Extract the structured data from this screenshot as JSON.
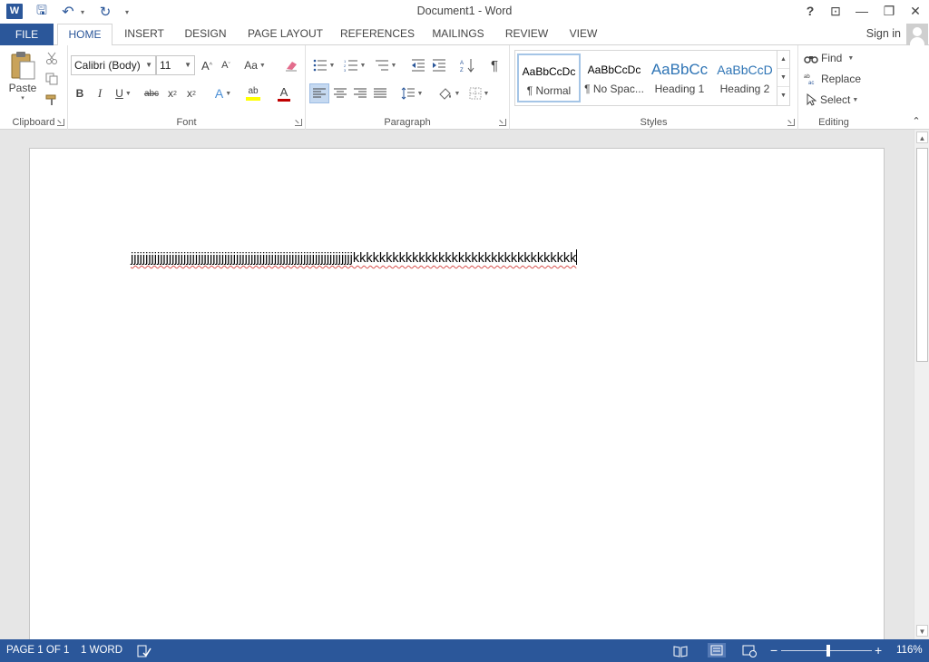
{
  "window": {
    "title": "Document1 - Word",
    "app_icon_letter": "W",
    "help": "?",
    "ribbon_options": "⊡",
    "minimize": "—",
    "restore": "❐",
    "close": "✕"
  },
  "quick_access": {
    "save": "🖫",
    "undo": "↶",
    "undo_dd": "▾",
    "redo": "↻",
    "customize": "▾"
  },
  "tabs": {
    "file": "FILE",
    "items": [
      "HOME",
      "INSERT",
      "DESIGN",
      "PAGE LAYOUT",
      "REFERENCES",
      "MAILINGS",
      "REVIEW",
      "VIEW"
    ],
    "sign_in": "Sign in"
  },
  "ribbon": {
    "clipboard": {
      "label": "Clipboard",
      "paste": "Paste",
      "paste_dd": "▾"
    },
    "font": {
      "label": "Font",
      "font_name": "Calibri (Body)",
      "font_size": "11",
      "grow": "A",
      "shrink": "A",
      "case": "Aa",
      "bold": "B",
      "italic": "I",
      "underline": "U",
      "strike": "abc",
      "subscript": "x",
      "superscript": "x",
      "text_effects": "A",
      "highlight": "ab",
      "font_color": "A"
    },
    "paragraph": {
      "label": "Paragraph",
      "show_marks": "¶"
    },
    "styles": {
      "label": "Styles",
      "items": [
        {
          "sample": "AaBbCcDc",
          "name": "¶ Normal"
        },
        {
          "sample": "AaBbCcDc",
          "name": "¶ No Spac..."
        },
        {
          "sample": "AaBbCc",
          "name": "Heading 1"
        },
        {
          "sample": "AaBbCcD",
          "name": "Heading 2"
        }
      ]
    },
    "editing": {
      "label": "Editing",
      "find": "Find",
      "replace": "Replace",
      "select": "Select"
    }
  },
  "document": {
    "text": "jjjjjjjjjjjjjjjjjjjjjjjjjjjjjjjjjjjjjjjjjjjjjjjjjjjjjjjjjjjjjjjjjjjjjjjjjjjjkkkkkkkkkkkkkkkkkkkkkkkkkkkkkkkkkk"
  },
  "status": {
    "page": "PAGE 1 OF 1",
    "words": "1 WORD",
    "zoom": "116%",
    "zoom_minus": "−",
    "zoom_plus": "+"
  },
  "colors": {
    "accent": "#2b579a",
    "highlight_bar": "#ffff00",
    "font_color_bar": "#c00000"
  }
}
